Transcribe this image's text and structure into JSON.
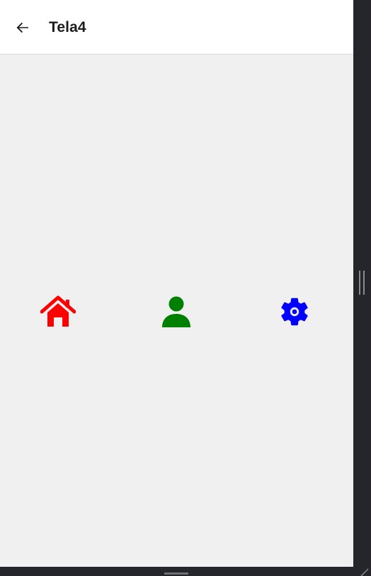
{
  "header": {
    "back_icon": "arrow-left-icon",
    "title": "Tela4"
  },
  "icons": [
    {
      "name": "home-icon",
      "color": "#ff0000"
    },
    {
      "name": "person-icon",
      "color": "#008000"
    },
    {
      "name": "gear-icon",
      "color": "#0000ff"
    }
  ],
  "colors": {
    "header_background": "#ffffff",
    "content_background": "#f0f0f0",
    "window_frame": "#25262b",
    "title_text": "#1c1c1e"
  }
}
